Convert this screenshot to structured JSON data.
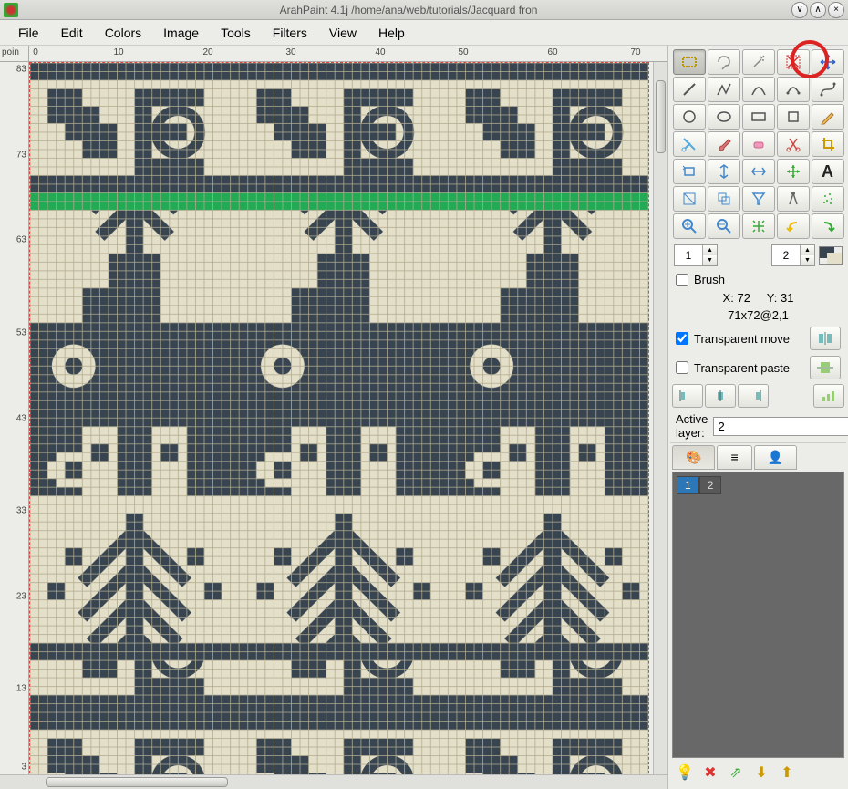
{
  "title": "ArahPaint 4.1j /home/ana/web/tutorials/Jacquard fron",
  "menu": [
    "File",
    "Edit",
    "Colors",
    "Image",
    "Tools",
    "Filters",
    "View",
    "Help"
  ],
  "ruler_label": "poin",
  "ruler_top": [
    "0",
    "10",
    "20",
    "30",
    "40",
    "50",
    "60",
    "70"
  ],
  "ruler_left": [
    "83",
    "73",
    "63",
    "53",
    "43",
    "33",
    "23",
    "13",
    "3"
  ],
  "brush": {
    "value": "1",
    "checkbox_label": "Brush",
    "color_index": "2"
  },
  "coords": {
    "x_label": "X:",
    "x": "72",
    "y_label": "Y:",
    "y": "31",
    "info": "71x72@2,1"
  },
  "transparent_move": "Transparent move",
  "transparent_paste": "Transparent paste",
  "active_layer": {
    "label": "Active layer:",
    "value": "2"
  },
  "layer_tabs": [
    "1",
    "2"
  ],
  "tool_icons": [
    "rect-select",
    "lasso",
    "wand",
    "x-select",
    "move",
    "line",
    "polyline",
    "curve",
    "arc",
    "bezier",
    "ellipse",
    "oval",
    "rect",
    "square",
    "pencil",
    "cut",
    "brush",
    "eraser",
    "scissors",
    "crop",
    "rect-rotate",
    "flip-v",
    "flip-h",
    "arrows-move",
    "text",
    "resize",
    "copy",
    "funnel",
    "compass",
    "spray",
    "zoom-in",
    "zoom-out",
    "fit",
    "undo",
    "redo"
  ],
  "align_icons_a": [
    "mirror-v",
    "mirror-h"
  ],
  "align_icons_b": [
    "align-l",
    "align-c",
    "align-r",
    "align-dist"
  ],
  "tab_icons": [
    "palette",
    "layers",
    "user"
  ],
  "bottom_icons": [
    "bulb",
    "delete",
    "merge",
    "lower",
    "raise"
  ]
}
